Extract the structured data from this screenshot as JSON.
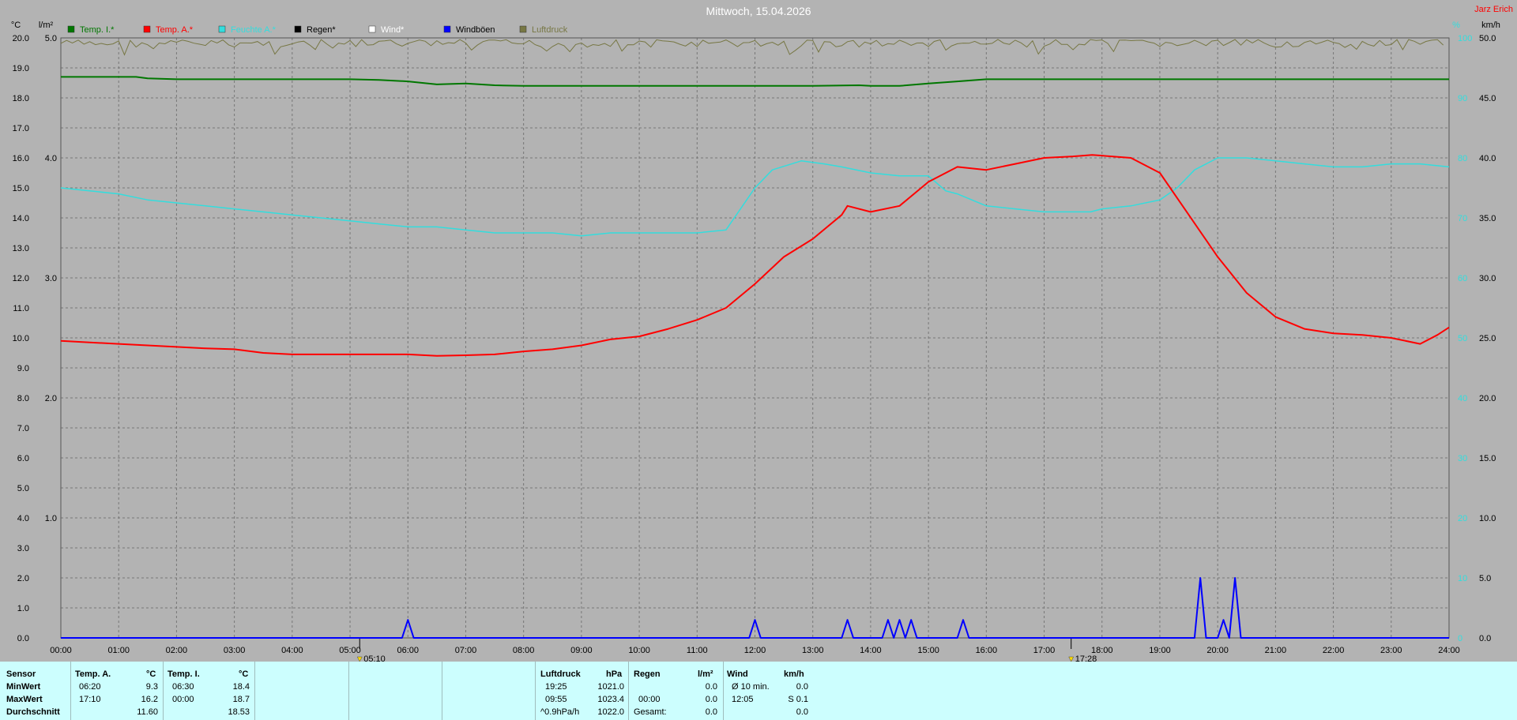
{
  "title": "Mittwoch, 15.04.2026",
  "author": "Jarz Erich",
  "colors": {
    "background": "#b3b3b3",
    "temp_inside": "#007700",
    "temp_outside": "#ff0000",
    "humidity": "#33dddd",
    "rain": "#000000",
    "wind": "#ffffff",
    "gusts": "#0000ff",
    "pressure": "#777744",
    "panel": "#ccfefe"
  },
  "axes": {
    "left_unit": "°C",
    "rain_unit": "l/m²",
    "right_unit_1": "%",
    "right_unit_2": "km/h",
    "temp_ticks": [
      "0.0",
      "1.0",
      "2.0",
      "3.0",
      "4.0",
      "5.0",
      "6.0",
      "7.0",
      "8.0",
      "9.0",
      "10.0",
      "11.0",
      "12.0",
      "13.0",
      "14.0",
      "15.0",
      "16.0",
      "17.0",
      "18.0",
      "19.0",
      "20.0"
    ],
    "rain_ticks": [
      "1.0",
      "2.0",
      "3.0",
      "4.0",
      "5.0"
    ],
    "humidity_ticks": [
      "0",
      "10",
      "20",
      "30",
      "40",
      "50",
      "60",
      "70",
      "80",
      "90",
      "100"
    ],
    "wind_ticks": [
      "0.0",
      "5.0",
      "10.0",
      "15.0",
      "20.0",
      "25.0",
      "30.0",
      "35.0",
      "40.0",
      "45.0",
      "50.0"
    ],
    "time_ticks": [
      "00:00",
      "01:00",
      "02:00",
      "03:00",
      "04:00",
      "05:00",
      "06:00",
      "07:00",
      "08:00",
      "09:00",
      "10:00",
      "11:00",
      "12:00",
      "13:00",
      "14:00",
      "15:00",
      "16:00",
      "17:00",
      "18:00",
      "19:00",
      "20:00",
      "21:00",
      "22:00",
      "23:00",
      "24:00"
    ],
    "sunrise": "05:10",
    "sunset": "17:28"
  },
  "legend": [
    {
      "label": "Temp. I.*",
      "key": "temp_inside"
    },
    {
      "label": "Temp. A.*",
      "key": "temp_outside"
    },
    {
      "label": "Feuchte A.*",
      "key": "humidity"
    },
    {
      "label": "Regen*",
      "key": "rain"
    },
    {
      "label": "Wind*",
      "key": "wind"
    },
    {
      "label": "Windböen",
      "key": "gusts"
    },
    {
      "label": "Luftdruck",
      "key": "pressure"
    }
  ],
  "chart_data": {
    "type": "line",
    "title": "Mittwoch, 15.04.2026",
    "x_unit": "hours",
    "xlim": [
      0,
      24
    ],
    "ylim_temp": [
      0,
      20
    ],
    "ylim_rain": [
      0,
      5
    ],
    "ylim_humidity": [
      0,
      100
    ],
    "ylim_wind": [
      0,
      50
    ],
    "grid": true,
    "series": [
      {
        "name": "Temp. A.*",
        "unit": "°C",
        "points": [
          [
            0,
            9.9
          ],
          [
            0.5,
            9.85
          ],
          [
            1,
            9.8
          ],
          [
            1.5,
            9.75
          ],
          [
            2,
            9.7
          ],
          [
            2.5,
            9.65
          ],
          [
            3,
            9.62
          ],
          [
            3.5,
            9.5
          ],
          [
            4,
            9.45
          ],
          [
            4.5,
            9.45
          ],
          [
            5,
            9.45
          ],
          [
            5.5,
            9.45
          ],
          [
            6,
            9.45
          ],
          [
            6.5,
            9.4
          ],
          [
            7,
            9.42
          ],
          [
            7.5,
            9.45
          ],
          [
            8,
            9.55
          ],
          [
            8.5,
            9.62
          ],
          [
            9,
            9.75
          ],
          [
            9.5,
            9.95
          ],
          [
            10,
            10.05
          ],
          [
            10.5,
            10.3
          ],
          [
            11,
            10.6
          ],
          [
            11.5,
            11.0
          ],
          [
            12,
            11.8
          ],
          [
            12.5,
            12.7
          ],
          [
            13,
            13.3
          ],
          [
            13.5,
            14.1
          ],
          [
            13.6,
            14.4
          ],
          [
            14,
            14.2
          ],
          [
            14.5,
            14.4
          ],
          [
            15,
            15.2
          ],
          [
            15.5,
            15.7
          ],
          [
            16,
            15.6
          ],
          [
            16.5,
            15.8
          ],
          [
            17,
            16.0
          ],
          [
            17.5,
            16.05
          ],
          [
            17.83,
            16.1
          ],
          [
            18.5,
            16.0
          ],
          [
            19,
            15.5
          ],
          [
            19.5,
            14.1
          ],
          [
            20,
            12.7
          ],
          [
            20.5,
            11.5
          ],
          [
            21,
            10.7
          ],
          [
            21.5,
            10.3
          ],
          [
            22,
            10.15
          ],
          [
            22.5,
            10.1
          ],
          [
            23,
            10.0
          ],
          [
            23.5,
            9.8
          ],
          [
            23.8,
            10.1
          ],
          [
            24,
            10.35
          ]
        ]
      },
      {
        "name": "Temp. I.*",
        "unit": "°C",
        "points": [
          [
            0,
            18.7
          ],
          [
            1,
            18.7
          ],
          [
            1.3,
            18.7
          ],
          [
            1.5,
            18.65
          ],
          [
            2,
            18.62
          ],
          [
            3,
            18.62
          ],
          [
            4,
            18.62
          ],
          [
            5,
            18.62
          ],
          [
            5.5,
            18.6
          ],
          [
            6,
            18.55
          ],
          [
            6.5,
            18.45
          ],
          [
            7,
            18.48
          ],
          [
            7.5,
            18.42
          ],
          [
            8,
            18.4
          ],
          [
            9,
            18.4
          ],
          [
            10,
            18.4
          ],
          [
            11,
            18.4
          ],
          [
            12,
            18.4
          ],
          [
            13,
            18.4
          ],
          [
            13.8,
            18.42
          ],
          [
            14,
            18.4
          ],
          [
            14.5,
            18.4
          ],
          [
            15,
            18.48
          ],
          [
            15.5,
            18.55
          ],
          [
            16,
            18.62
          ],
          [
            17,
            18.62
          ],
          [
            18,
            18.62
          ],
          [
            19,
            18.62
          ],
          [
            20,
            18.62
          ],
          [
            21,
            18.62
          ],
          [
            22,
            18.62
          ],
          [
            23,
            18.62
          ],
          [
            24,
            18.62
          ]
        ]
      },
      {
        "name": "Feuchte A.*",
        "unit": "%",
        "points": [
          [
            0,
            75
          ],
          [
            0.5,
            74.5
          ],
          [
            1,
            74
          ],
          [
            1.5,
            73
          ],
          [
            2,
            72.5
          ],
          [
            2.5,
            72
          ],
          [
            3,
            71.5
          ],
          [
            3.5,
            71
          ],
          [
            4,
            70.5
          ],
          [
            4.5,
            70
          ],
          [
            5,
            69.5
          ],
          [
            5.5,
            69
          ],
          [
            6,
            68.5
          ],
          [
            6.5,
            68.5
          ],
          [
            7,
            68
          ],
          [
            7.5,
            67.5
          ],
          [
            8,
            67.5
          ],
          [
            8.5,
            67.5
          ],
          [
            9,
            67
          ],
          [
            9.5,
            67.5
          ],
          [
            10,
            67.5
          ],
          [
            10.5,
            67.5
          ],
          [
            11,
            67.5
          ],
          [
            11.5,
            68
          ],
          [
            12,
            75
          ],
          [
            12.3,
            78
          ],
          [
            12.8,
            79.5
          ],
          [
            13.2,
            79
          ],
          [
            13.5,
            78.5
          ],
          [
            14,
            77.5
          ],
          [
            14.5,
            77
          ],
          [
            15,
            77
          ],
          [
            15.3,
            74.5
          ],
          [
            15.5,
            74
          ],
          [
            16,
            72
          ],
          [
            16.5,
            71.5
          ],
          [
            17,
            71
          ],
          [
            17.5,
            71
          ],
          [
            17.8,
            71
          ],
          [
            18,
            71.5
          ],
          [
            18.5,
            72
          ],
          [
            19,
            73
          ],
          [
            19.3,
            75
          ],
          [
            19.6,
            78
          ],
          [
            20,
            80
          ],
          [
            20.5,
            80
          ],
          [
            21,
            79.5
          ],
          [
            21.5,
            79
          ],
          [
            22,
            78.5
          ],
          [
            22.5,
            78.5
          ],
          [
            23,
            79
          ],
          [
            23.5,
            79
          ],
          [
            24,
            78.5
          ]
        ]
      },
      {
        "name": "Windböen",
        "unit": "km/h",
        "peaks": [
          [
            6.0,
            1.5
          ],
          [
            12.0,
            1.5
          ],
          [
            13.6,
            1.5
          ],
          [
            14.3,
            1.5
          ],
          [
            14.5,
            1.5
          ],
          [
            14.7,
            1.5
          ],
          [
            15.6,
            1.5
          ],
          [
            19.7,
            5.0
          ],
          [
            20.1,
            1.5
          ],
          [
            20.3,
            5.0
          ]
        ]
      },
      {
        "name": "Luftdruck",
        "unit": "hPa",
        "values_hPa": [
          1021.0,
          1023.4,
          1022.0
        ]
      }
    ]
  },
  "stats": {
    "sensor_label": "Sensor",
    "row_labels": [
      "MinWert",
      "MaxWert",
      "Durchschnitt"
    ],
    "temp_a": {
      "header": "Temp. A.",
      "unit": "°C",
      "min_time": "06:20",
      "min": "9.3",
      "max_time": "17:10",
      "max": "16.2",
      "avg": "11.60"
    },
    "temp_i": {
      "header": "Temp. I.",
      "unit": "°C",
      "min_time": "06:30",
      "min": "18.4",
      "max_time": "00:00",
      "max": "18.7",
      "avg": "18.53"
    },
    "pressure": {
      "header": "Luftdruck",
      "unit": "hPa",
      "row1_label": "19:25",
      "row1": "1021.0",
      "row2_label": "09:55",
      "row2": "1023.4",
      "row3_label": "^0.9hPa/h",
      "row3": "1022.0"
    },
    "rain": {
      "header": "Regen",
      "unit": "l/m²",
      "row2_label": "00:00",
      "row2": "0.0",
      "row3_label": "Gesamt:",
      "row3": "0.0",
      "row1": "0.0"
    },
    "wind": {
      "header": "Wind",
      "unit": "km/h",
      "row1_label": "Ø 10 min.",
      "row1": "0.0",
      "row2_label": "12:05",
      "row2": "S 0.1",
      "row3": "0.0"
    }
  }
}
